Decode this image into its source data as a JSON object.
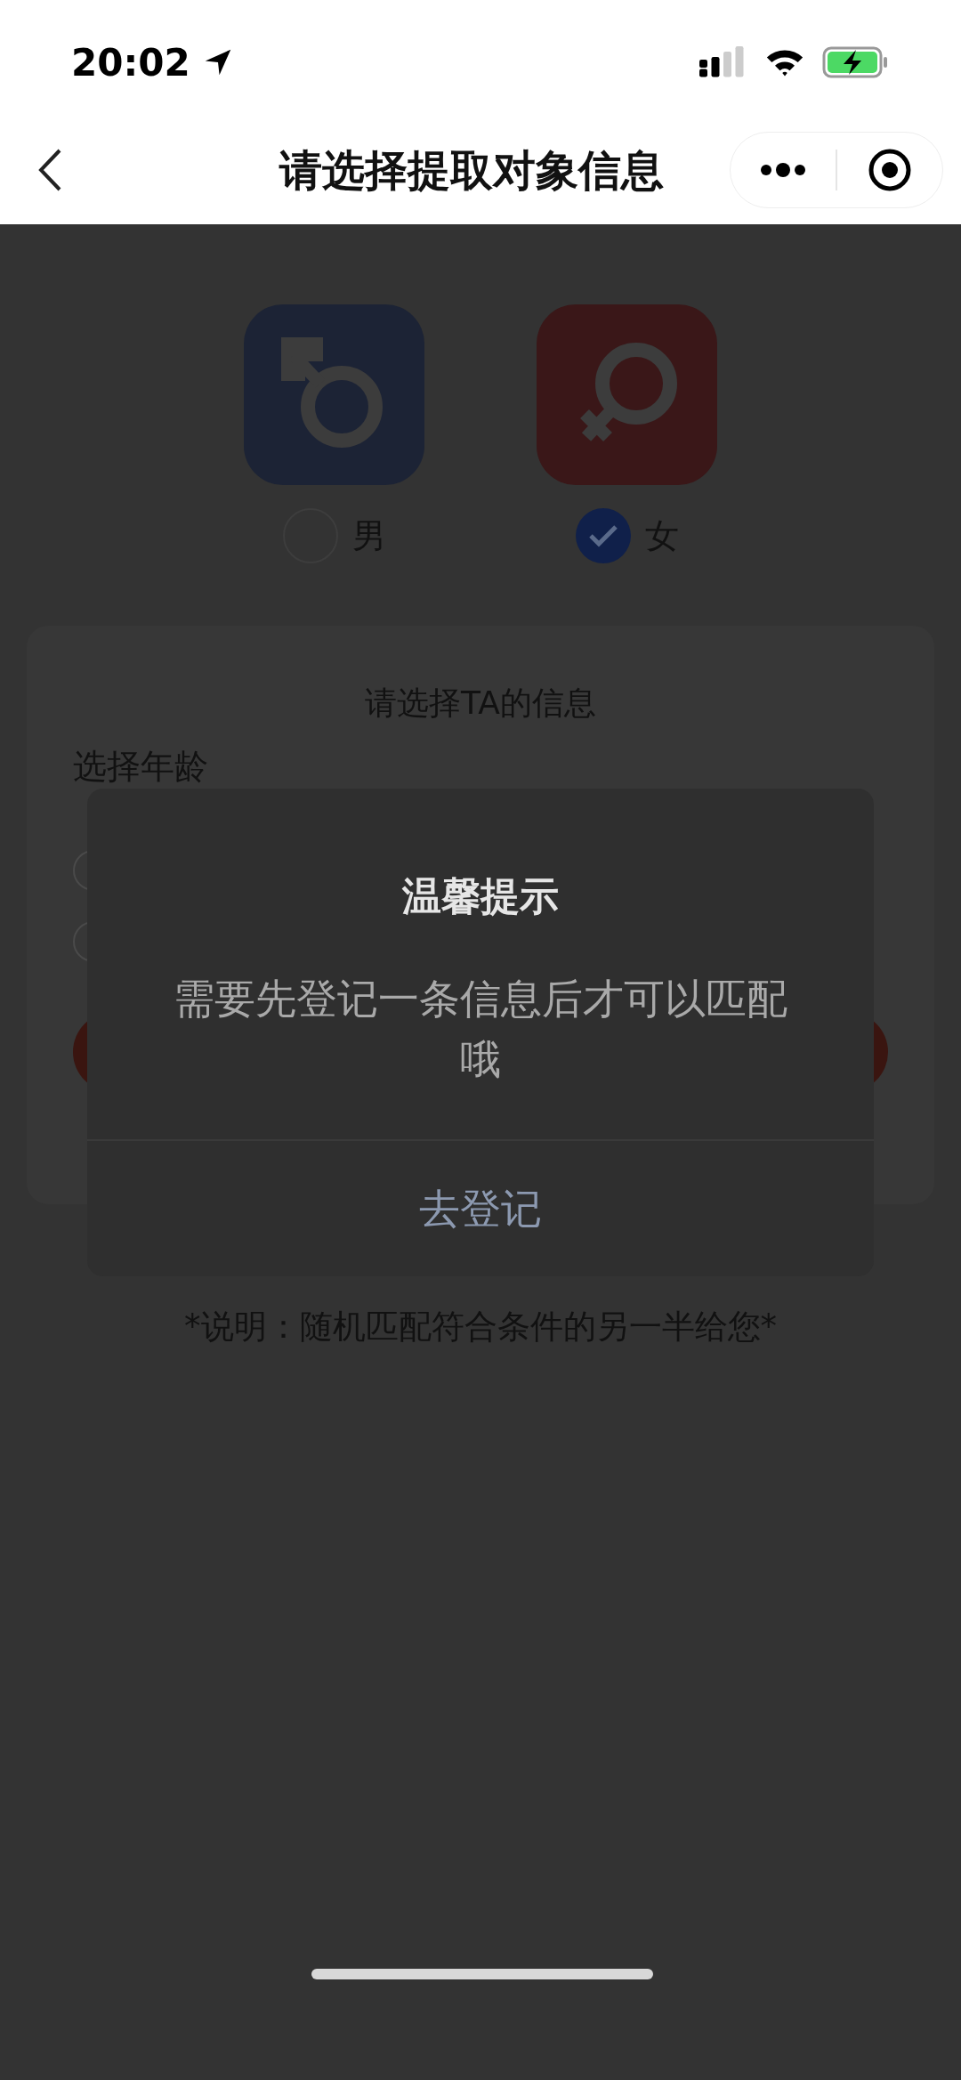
{
  "status_bar": {
    "time": "20:02"
  },
  "nav_bar": {
    "title": "请选择提取对象信息"
  },
  "genders": [
    {
      "kind": "male",
      "label": "男",
      "selected": false
    },
    {
      "kind": "female",
      "label": "女",
      "selected": true
    }
  ],
  "card": {
    "title": "请选择TA的信息",
    "section_label": "选择年龄",
    "age_options": [
      {
        "selected": false
      },
      {
        "selected": false
      }
    ]
  },
  "dialog": {
    "title": "温馨提示",
    "message": "需要先登记一条信息后才可以匹配哦",
    "button": "去登记"
  },
  "note": "*说明：随机匹配符合条件的另一半给您*"
}
